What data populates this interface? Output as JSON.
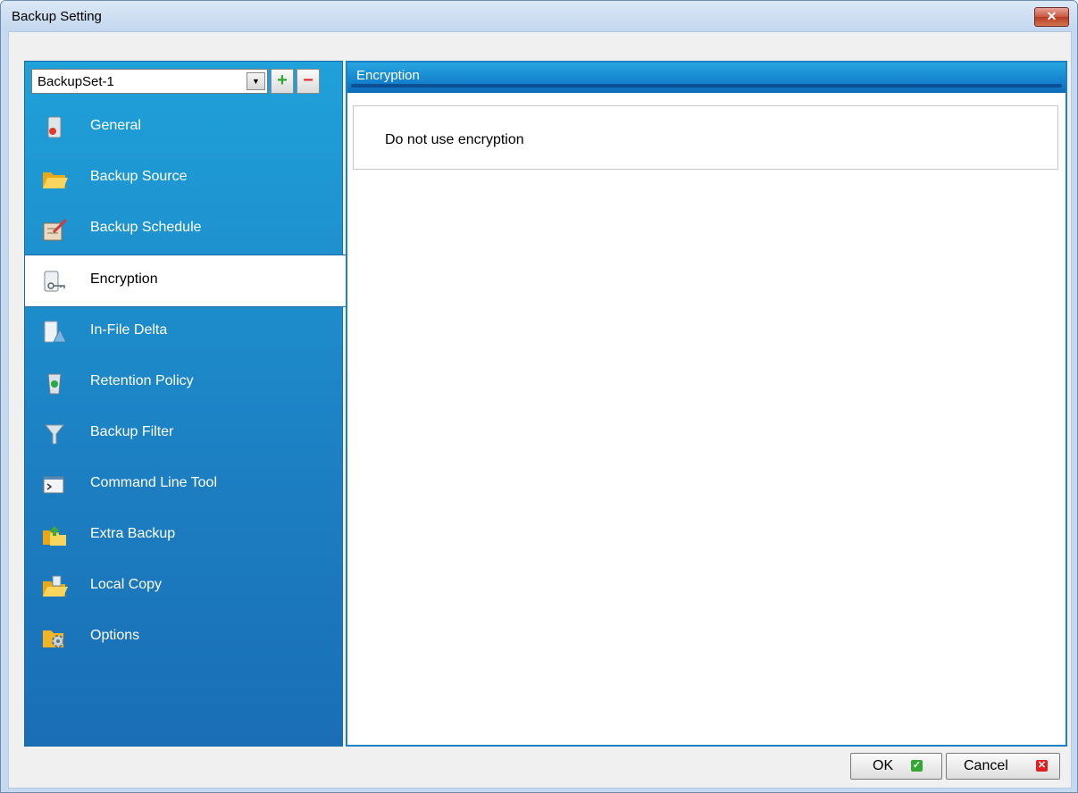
{
  "window": {
    "title": "Backup Setting",
    "close_label": "✕"
  },
  "backup_set": {
    "selected": "BackupSet-1",
    "dropdown_arrow": "▼",
    "add_label": "+",
    "remove_label": "−"
  },
  "sidebar": {
    "items": [
      {
        "label": "General",
        "icon": "general-icon"
      },
      {
        "label": "Backup Source",
        "icon": "folder-icon"
      },
      {
        "label": "Backup Schedule",
        "icon": "calendar-icon"
      },
      {
        "label": "Encryption",
        "icon": "key-icon",
        "active": true
      },
      {
        "label": "In-File Delta",
        "icon": "delta-icon"
      },
      {
        "label": "Retention Policy",
        "icon": "recycle-bin-icon"
      },
      {
        "label": "Backup Filter",
        "icon": "filter-icon"
      },
      {
        "label": "Command Line Tool",
        "icon": "terminal-icon"
      },
      {
        "label": "Extra Backup",
        "icon": "extra-backup-icon"
      },
      {
        "label": "Local Copy",
        "icon": "local-copy-icon"
      },
      {
        "label": "Options",
        "icon": "options-icon"
      }
    ]
  },
  "panel": {
    "title": "Encryption",
    "message": "Do not use encryption"
  },
  "footer": {
    "ok_label": "OK",
    "cancel_label": "Cancel"
  },
  "colors": {
    "sidebar_top": "#1fa1d9",
    "sidebar_bottom": "#1a6eb5",
    "panel_header": "#1584cf",
    "ok_icon": "#33a833",
    "cancel_icon": "#e02020"
  }
}
